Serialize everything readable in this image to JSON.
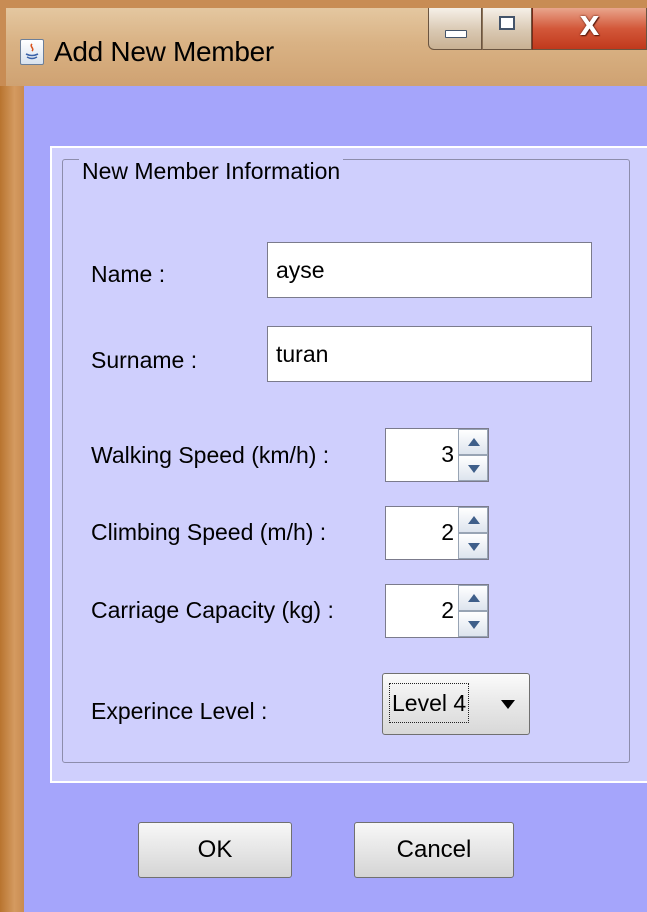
{
  "window": {
    "title": "Add New Member",
    "controls": {
      "minimize": "minimize",
      "maximize": "maximize",
      "close": "X"
    },
    "colors": {
      "client_bg": "#a5a5fb",
      "group_bg": "#cfcffd",
      "frame": "#c88c54",
      "close": "#d3583a"
    }
  },
  "form": {
    "group_title": "New Member Information",
    "name_label": "Name :",
    "name_value": "ayse",
    "surname_label": "Surname :",
    "surname_value": "turan",
    "walking_label": "Walking Speed (km/h) :",
    "walking_value": "3",
    "climbing_label": "Climbing Speed (m/h) :",
    "climbing_value": "2",
    "carriage_label": "Carriage Capacity (kg) :",
    "carriage_value": "2",
    "experience_label": "Experince Level :",
    "experience_value": "Level 4"
  },
  "buttons": {
    "ok": "OK",
    "cancel": "Cancel"
  }
}
